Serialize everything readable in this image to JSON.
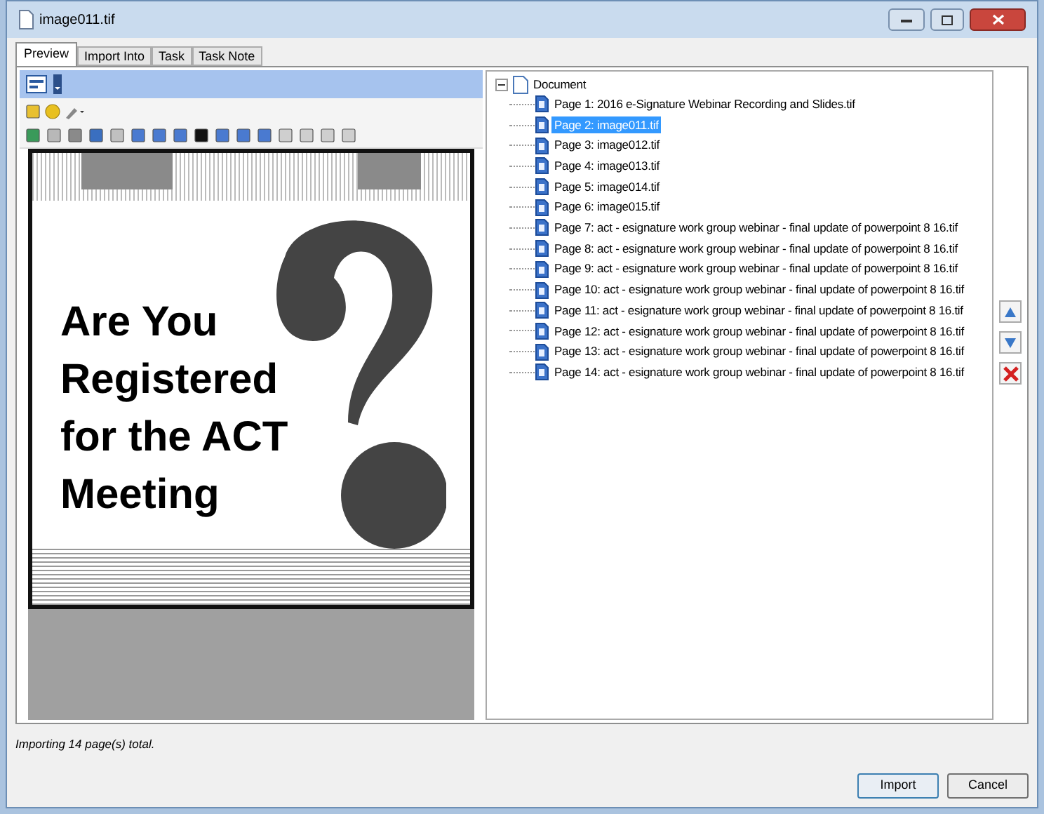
{
  "window": {
    "title": "image011.tif"
  },
  "tabs": [
    {
      "label": "Preview",
      "selected": true
    },
    {
      "label": "Import Into",
      "selected": false
    },
    {
      "label": "Task",
      "selected": false
    },
    {
      "label": "Task Note",
      "selected": false
    }
  ],
  "preview": {
    "lines": [
      "Are You",
      "Registered",
      "for the ACT",
      "Meeting"
    ]
  },
  "tree": {
    "label": "Document",
    "expanded": true,
    "children": [
      {
        "label": "Page 1: 2016 e-Signature Webinar Recording and Slides.tif",
        "selected": false
      },
      {
        "label": "Page 2: image011.tif",
        "selected": true
      },
      {
        "label": "Page 3: image012.tif",
        "selected": false
      },
      {
        "label": "Page 4: image013.tif",
        "selected": false
      },
      {
        "label": "Page 5: image014.tif",
        "selected": false
      },
      {
        "label": "Page 6: image015.tif",
        "selected": false
      },
      {
        "label": "Page 7: act - esignature work group webinar - final update of powerpoint 8 16.tif",
        "selected": false
      },
      {
        "label": "Page 8: act - esignature work group webinar - final update of powerpoint 8 16.tif",
        "selected": false
      },
      {
        "label": "Page 9: act - esignature work group webinar - final update of powerpoint 8 16.tif",
        "selected": false
      },
      {
        "label": "Page 10: act - esignature work group webinar - final update of powerpoint 8 16.tif",
        "selected": false
      },
      {
        "label": "Page 11: act - esignature work group webinar - final update of powerpoint 8 16.tif",
        "selected": false
      },
      {
        "label": "Page 12: act - esignature work group webinar - final update of powerpoint 8 16.tif",
        "selected": false
      },
      {
        "label": "Page 13: act - esignature work group webinar - final update of powerpoint 8 16.tif",
        "selected": false
      },
      {
        "label": "Page 14: act - esignature work group webinar - final update of powerpoint 8 16.tif",
        "selected": false
      }
    ]
  },
  "status": "Importing 14 page(s) total.",
  "buttons": [
    {
      "label": "Import",
      "default": true
    },
    {
      "label": "Cancel",
      "default": false
    }
  ]
}
